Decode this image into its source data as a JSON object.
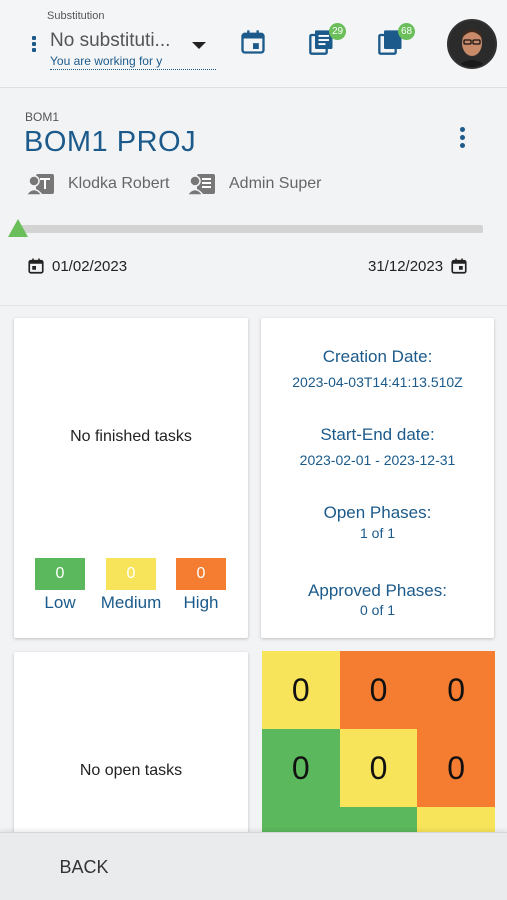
{
  "topbar": {
    "substitution_label": "Substitution",
    "substitution_value": "No substituti...",
    "substitution_hint": "You are working for y",
    "icons": [
      "calendar-icon",
      "tasks-icon",
      "documents-icon"
    ],
    "badges": {
      "tasks": "29",
      "documents": "68"
    }
  },
  "project": {
    "code": "BOM1",
    "title": "BOM1 PROJ",
    "owner": "Klodka Robert",
    "admin": "Admin Super",
    "start_date": "01/02/2023",
    "end_date": "31/12/2023",
    "progress": 0
  },
  "finished_tasks": {
    "message": "No finished tasks",
    "severity": [
      {
        "label": "Low",
        "count": "0",
        "color": "#5cb85c"
      },
      {
        "label": "Medium",
        "count": "0",
        "color": "#f7e45a"
      },
      {
        "label": "High",
        "count": "0",
        "color": "#f47d31"
      }
    ]
  },
  "info": {
    "creation_label": "Creation Date:",
    "creation_value": "2023-04-03T14:41:13.510Z",
    "startend_label": "Start-End date:",
    "startend_value": "2023-02-01 - 2023-12-31",
    "open_label": "Open Phases:",
    "open_value": "1 of 1",
    "approved_label": "Approved Phases:",
    "approved_value": "0 of 1"
  },
  "open_tasks": {
    "message": "No open tasks"
  },
  "matrix": {
    "rows": [
      [
        {
          "value": "0",
          "color": "#f7e45a"
        },
        {
          "value": "0",
          "color": "#f47d31"
        },
        {
          "value": "0",
          "color": "#f47d31"
        }
      ],
      [
        {
          "value": "0",
          "color": "#5cb85c"
        },
        {
          "value": "0",
          "color": "#f7e45a"
        },
        {
          "value": "0",
          "color": "#f47d31"
        }
      ],
      [
        {
          "value": "",
          "color": "#5cb85c"
        },
        {
          "value": "",
          "color": "#5cb85c"
        },
        {
          "value": "",
          "color": "#f7e45a"
        }
      ]
    ]
  },
  "footer": {
    "back_label": "BACK"
  }
}
